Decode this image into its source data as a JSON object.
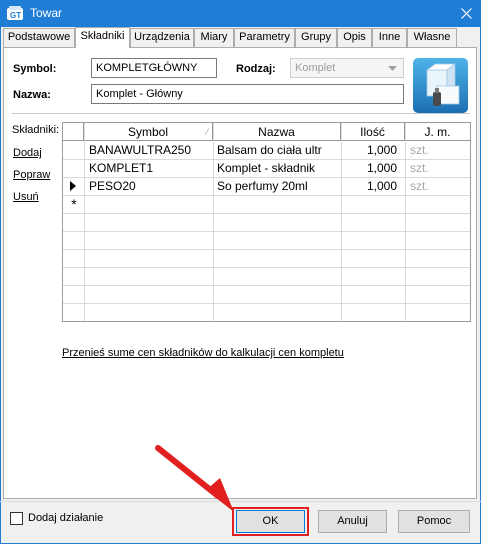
{
  "window": {
    "title": "Towar"
  },
  "tabs": [
    {
      "label": "Podstawowe",
      "active": false
    },
    {
      "label": "Składniki",
      "active": true
    },
    {
      "label": "Urządzenia",
      "active": false
    },
    {
      "label": "Miary",
      "active": false
    },
    {
      "label": "Parametry",
      "active": false
    },
    {
      "label": "Grupy",
      "active": false
    },
    {
      "label": "Opis",
      "active": false
    },
    {
      "label": "Inne",
      "active": false
    },
    {
      "label": "Własne",
      "active": false
    }
  ],
  "form": {
    "symbol_label": "Symbol:",
    "symbol_value": "KOMPLETGŁÓWNY",
    "rodzaj_label": "Rodzaj:",
    "rodzaj_value": "Komplet",
    "nazwa_label": "Nazwa:",
    "nazwa_value": "Komplet - Główny"
  },
  "sidebar": {
    "heading": "Składniki:",
    "links": [
      {
        "label": "Dodaj"
      },
      {
        "label": "Popraw"
      },
      {
        "label": "Usuń"
      }
    ]
  },
  "grid": {
    "columns": [
      "Symbol",
      "Nazwa",
      "Ilość",
      "J. m."
    ],
    "rows": [
      {
        "symbol": "BANAWULTRA250",
        "nazwa": "Balsam do ciała ultr",
        "ilosc": "1,000",
        "jm": "szt.",
        "current": false
      },
      {
        "symbol": "KOMPLET1",
        "nazwa": "Komplet - składnik",
        "ilosc": "1,000",
        "jm": "szt.",
        "current": false
      },
      {
        "symbol": "PESO20",
        "nazwa": "So perfumy 20ml",
        "ilosc": "1,000",
        "jm": "szt.",
        "current": true
      }
    ],
    "new_row_marker": "*"
  },
  "transfer_link": "Przenieś sume cen składników do kalkulacji cen kompletu",
  "footer": {
    "checkbox_label": "Dodaj działanie",
    "checkbox_checked": false,
    "ok_label": "OK",
    "cancel_label": "Anuluj",
    "help_label": "Pomoc"
  },
  "colors": {
    "titlebar": "#1f7dd5",
    "highlight": "#e0201f"
  }
}
